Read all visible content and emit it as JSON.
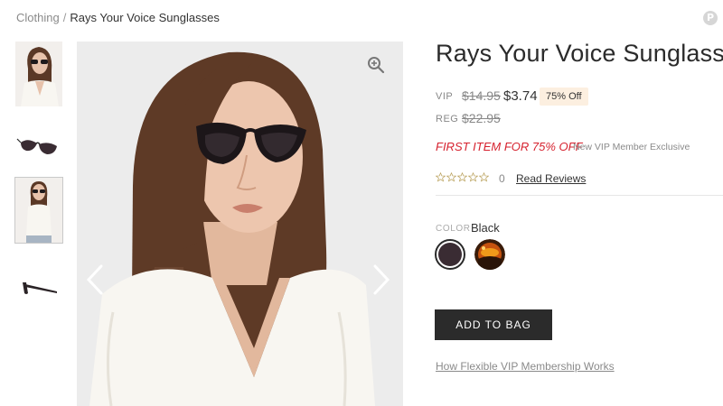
{
  "breadcrumb": {
    "parent": "Clothing",
    "separator": "/",
    "current": "Rays Your Voice Sunglasses"
  },
  "pin_icon_label": "P",
  "gallery": {
    "thumbnails": [
      {
        "name": "thumb-model-front",
        "active": false
      },
      {
        "name": "thumb-sunglasses-angle",
        "active": false
      },
      {
        "name": "thumb-model-full",
        "active": true
      },
      {
        "name": "thumb-sunglasses-side",
        "active": false
      }
    ],
    "icons": {
      "zoom": "zoom-in-icon",
      "prev": "chevron-left-icon",
      "next": "chevron-right-icon"
    }
  },
  "product": {
    "title": "Rays Your Voice Sunglasses",
    "vip_label": "VIP",
    "vip_original_price": "$14.95",
    "vip_price": "$3.74",
    "discount_badge": "75% Off",
    "reg_label": "REG",
    "reg_price": "$22.95",
    "promo": "FIRST ITEM FOR 75% OFF",
    "promo_note": "New VIP Member Exclusive",
    "rating": 0,
    "review_count": "0",
    "read_reviews": "Read Reviews",
    "color_label": "COLOR",
    "color_value": "Black",
    "swatches": [
      "Black",
      "Tortoise"
    ],
    "add_to_bag": "ADD TO BAG",
    "vip_link": "How Flexible VIP Membership Works"
  },
  "colors": {
    "promo_red": "#d6222f",
    "button_dark": "#2b2b2b",
    "badge_bg": "#fcefe0"
  }
}
